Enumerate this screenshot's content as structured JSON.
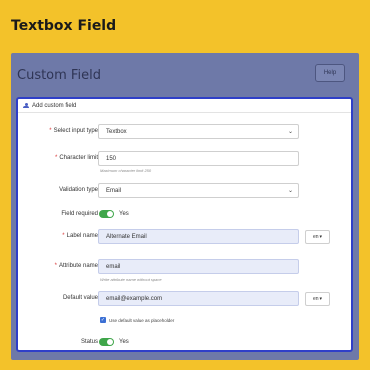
{
  "headline": "Textbox Field",
  "page": {
    "title": "Custom Field",
    "help_label": "Help"
  },
  "card": {
    "header": "Add custom field",
    "fields": {
      "input_type": {
        "label": "Select input type",
        "value": "Textbox"
      },
      "char_limit": {
        "label": "Character limit",
        "value": "150",
        "hint": "Maximum character limit 250"
      },
      "validation": {
        "label": "Validation type",
        "value": "Email"
      },
      "field_required": {
        "label": "Field required",
        "toggle_text": "Yes",
        "enabled": true
      },
      "label_name": {
        "label": "Label name",
        "value": "Alternate Email",
        "lang": "en"
      },
      "attribute_name": {
        "label": "Attribute name",
        "value": "email",
        "hint": "Write attribute name without space"
      },
      "default_value": {
        "label": "Default value",
        "value": "email@example.com",
        "lang": "en",
        "placeholder_check_label": "Use default value as placeholder",
        "placeholder_checked": true
      },
      "status": {
        "label": "Status",
        "toggle_text": "Yes",
        "enabled": true
      }
    }
  },
  "colors": {
    "background": "#f3c22a",
    "frame": "#6e79a8",
    "card_border": "#2f3fc8",
    "toggle_on": "#3fa64a",
    "required_star": "#d83232",
    "filled_input": "#e8ecf9"
  },
  "icons": {
    "card_header": "user-icon",
    "select_caret": "chevron-down-icon",
    "lang_caret": "caret-down-icon",
    "checkbox": "check-icon"
  }
}
